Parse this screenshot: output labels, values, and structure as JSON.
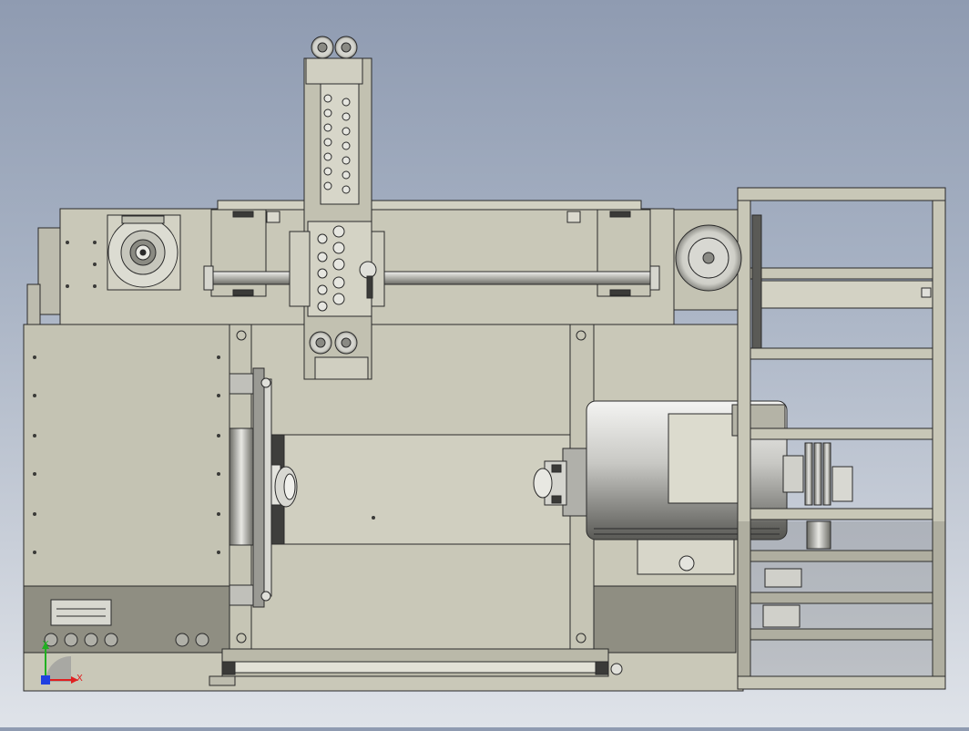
{
  "view": {
    "background_top": "#8f9bb1",
    "background_bottom": "#dfe3e9",
    "body_color": "#c9c8b8",
    "body_dark": "#8f8e82",
    "edge_color": "#2a2a2a",
    "metal_light": "#e4e4e0",
    "metal_dark": "#4a4a46"
  },
  "triad": {
    "x_label": "X",
    "y_label": "Y",
    "x_color": "#e02020",
    "y_color": "#20b020",
    "z_color": "#2040e0"
  },
  "icons": {
    "triad": "coordinate-triad-icon",
    "knob": "knob-icon",
    "bolt": "bolt-icon"
  }
}
